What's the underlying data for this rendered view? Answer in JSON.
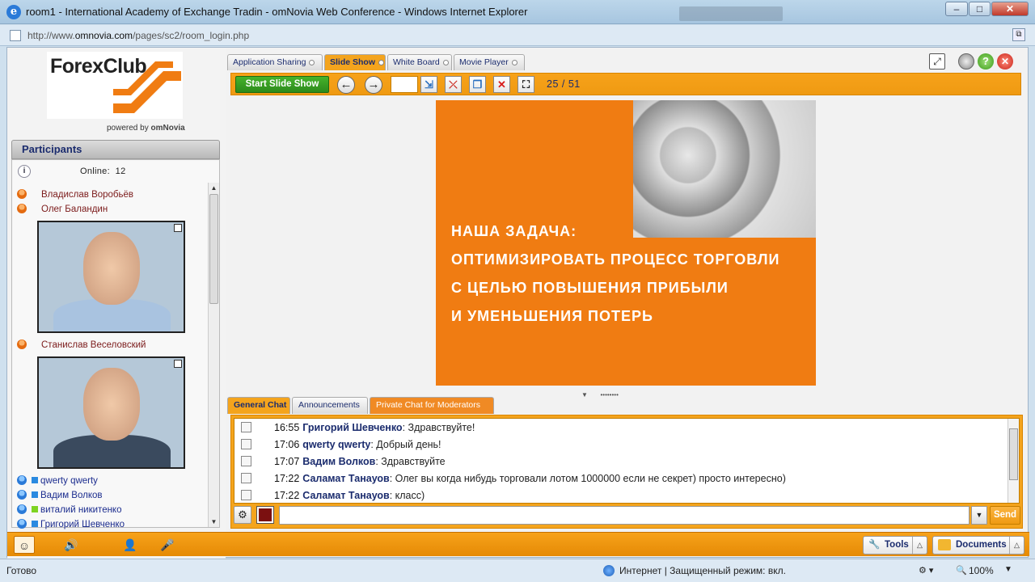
{
  "window": {
    "title": "room1 - International Academy of Exchange Tradin - omNovia Web Conference - Windows Internet Explorer"
  },
  "address": {
    "url_prefix": "http://www.",
    "url_host": "omnovia.com",
    "url_path": "/pages/sc2/room_login.php"
  },
  "brand": {
    "logo_text": "ForexClub",
    "powered_by": "powered by",
    "powered_brand": "omNovia"
  },
  "participants": {
    "title": "Participants",
    "online_label": "Online:",
    "online_count": "12",
    "moderators": [
      "Владислав Воробьёв",
      "Олег Баландин",
      "Станислав Веселовский"
    ],
    "attendees": [
      {
        "name": "qwerty qwerty",
        "color": "#2a8ae0"
      },
      {
        "name": "Вадим Волков",
        "color": "#2a8ae0"
      },
      {
        "name": "виталий никитенко",
        "color": "#7ed321"
      },
      {
        "name": "Григорий Шевченко",
        "color": "#2a8ae0"
      }
    ]
  },
  "tabs": [
    "Application Sharing",
    "Slide Show",
    "White Board",
    "Movie Player"
  ],
  "slideshow": {
    "start_label": "Start Slide Show",
    "page_value": "",
    "page_count": "25 / 51"
  },
  "slide": {
    "lines": [
      "НАША ЗАДАЧА:",
      "ОПТИМИЗИРОВАТЬ ПРОЦЕСС ТОРГОВЛИ",
      "С ЦЕЛЬЮ ПОВЫШЕНИЯ ПРИБЫЛИ",
      "И УМЕНЬШЕНИЯ ПОТЕРЬ"
    ],
    "bg_color": "#f07c12"
  },
  "chat": {
    "tabs": [
      "General Chat",
      "Announcements",
      "Private Chat for Moderators"
    ],
    "messages": [
      {
        "time": "16:55",
        "who": "Григорий Шевченко",
        "text": ": Здравствуйте!"
      },
      {
        "time": "17:06",
        "who": "qwerty qwerty",
        "text": ": Добрый день!"
      },
      {
        "time": "17:07",
        "who": "Вадим Волков",
        "text": ": Здравствуйте"
      },
      {
        "time": "17:22",
        "who": "Саламат Танауов",
        "text": ": Олег вы когда нибудь торговали лотом 1000000 если не секрет) просто интересно)"
      },
      {
        "time": "17:22",
        "who": "Саламат Танауов",
        "text": ": класс)"
      }
    ],
    "input_value": "",
    "send_label": "Send",
    "text_color": "#7b1010"
  },
  "bottom": {
    "tools_label": "Tools",
    "documents_label": "Documents"
  },
  "status": {
    "left": "Готово",
    "zone": "Интернет | Защищенный режим: вкл.",
    "zoom": "100%"
  },
  "colors": {
    "accent": "#f4a41d",
    "brand_orange": "#f07c12",
    "start_green": "#2c8a1b",
    "link_navy": "#1b2c6e"
  }
}
